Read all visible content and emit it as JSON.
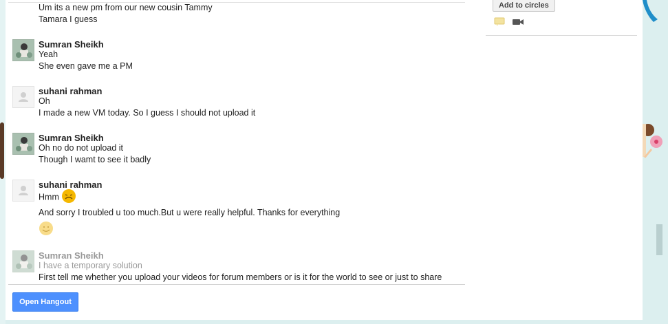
{
  "chat": {
    "partial_message": {
      "lines": [
        "Um its a new pm from our new cousin Tammy",
        "Tamara I guess"
      ]
    },
    "messages": [
      {
        "author": "Sumran Sheikh",
        "lines": [
          "Yeah",
          "She even gave me a PM"
        ]
      },
      {
        "author": "suhani rahman",
        "lines": [
          "Oh",
          "I made a new VM today. So I guess I should not upload it"
        ]
      },
      {
        "author": "Sumran Sheikh",
        "lines": [
          "Oh no do not upload it",
          "Though I wamt to see it badly"
        ]
      },
      {
        "author": "suhani rahman",
        "lines": [
          "Hmm",
          "And sorry I troubled u too much.But u were really helpful. Thanks for everything"
        ]
      },
      {
        "author": "Sumran Sheikh",
        "lines": [
          "I have a temporary solution",
          "First tell me whether you upload your videos for forum members or is it for the world to see or just to share"
        ]
      }
    ],
    "open_hangout_label": "Open Hangout"
  },
  "sidebar": {
    "add_to_circles_label": "Add to circles",
    "icons": [
      "chat-bubble-icon",
      "video-camera-icon"
    ]
  },
  "colors": {
    "primary_button": "#4d90fe",
    "page_background": "#dcefef",
    "faded_text": "#999999"
  }
}
